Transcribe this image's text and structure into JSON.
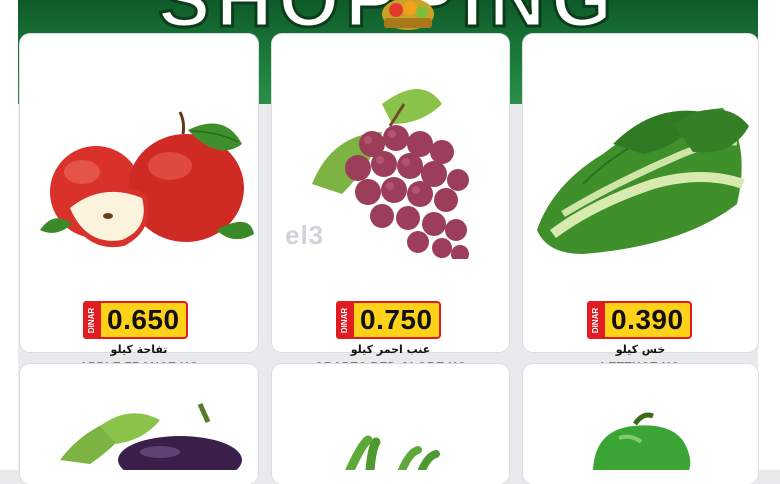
{
  "banner": {
    "title": "SHOPPING",
    "background": "#1b7a3a"
  },
  "watermark": "el3",
  "products": [
    {
      "name_en": "APPLE FRANCE KG",
      "name_ar": "تفاحة كيلو",
      "price": "0.650",
      "currency": "DINAR",
      "icon": "apple-icon"
    },
    {
      "name_en": "GRAPES RED GLOBE KG",
      "name_ar": "عنب احمر كيلو",
      "price": "0.750",
      "currency": "DINAR",
      "icon": "grapes-icon"
    },
    {
      "name_en": "LETTUCE KG",
      "name_ar": "خس كيلو",
      "price": "0.390",
      "currency": "DINAR",
      "icon": "lettuce-icon"
    }
  ],
  "next_row": [
    {
      "icon": "eggplant-icon"
    },
    {
      "icon": "green-beans-icon"
    },
    {
      "icon": "green-pepper-icon"
    }
  ],
  "colors": {
    "price_bg": "#ffd21a",
    "price_border": "#e11b22",
    "currency_bg": "#e11b22"
  }
}
